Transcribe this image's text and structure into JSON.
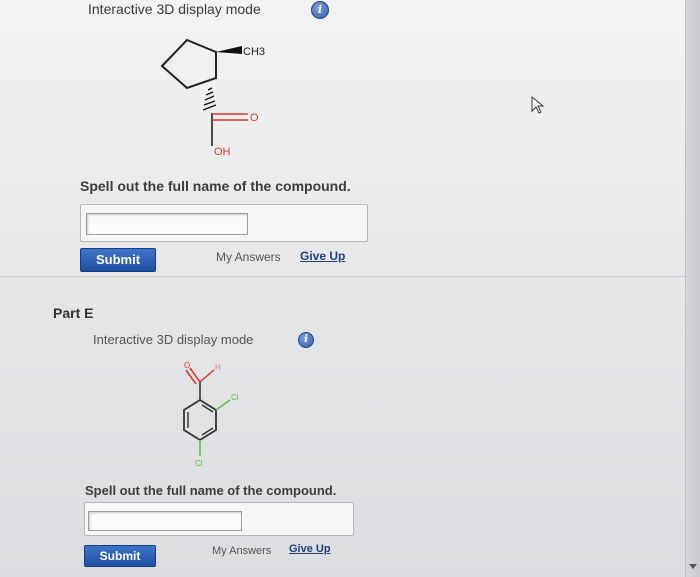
{
  "part_d": {
    "mode_label": "Interactive 3D display mode",
    "info_icon": "info-icon",
    "molecule": {
      "substituent_top": "CH3",
      "carbonyl_o": "O",
      "hydroxyl": "OH"
    },
    "question": "Spell out the full name of the compound.",
    "answer_value": "",
    "submit_label": "Submit",
    "my_answers_label": "My Answers",
    "give_up_label": "Give Up"
  },
  "part_e": {
    "part_label": "Part E",
    "mode_label": "Interactive 3D display mode",
    "info_icon": "info-icon",
    "molecule": {
      "aldehyde_o": "O",
      "aldehyde_h": "H",
      "substituent_right": "Cl",
      "substituent_bottom": "Cl"
    },
    "question": "Spell out the full name of the compound.",
    "answer_value": "",
    "submit_label": "Submit",
    "my_answers_label": "My Answers",
    "give_up_label": "Give Up"
  },
  "colors": {
    "submit": "#2a5db3",
    "link": "#1f3f7a",
    "oxygen": "#d9352b",
    "chlorine": "#5fbf3f"
  },
  "cursor_icon": "mouse-pointer-icon"
}
